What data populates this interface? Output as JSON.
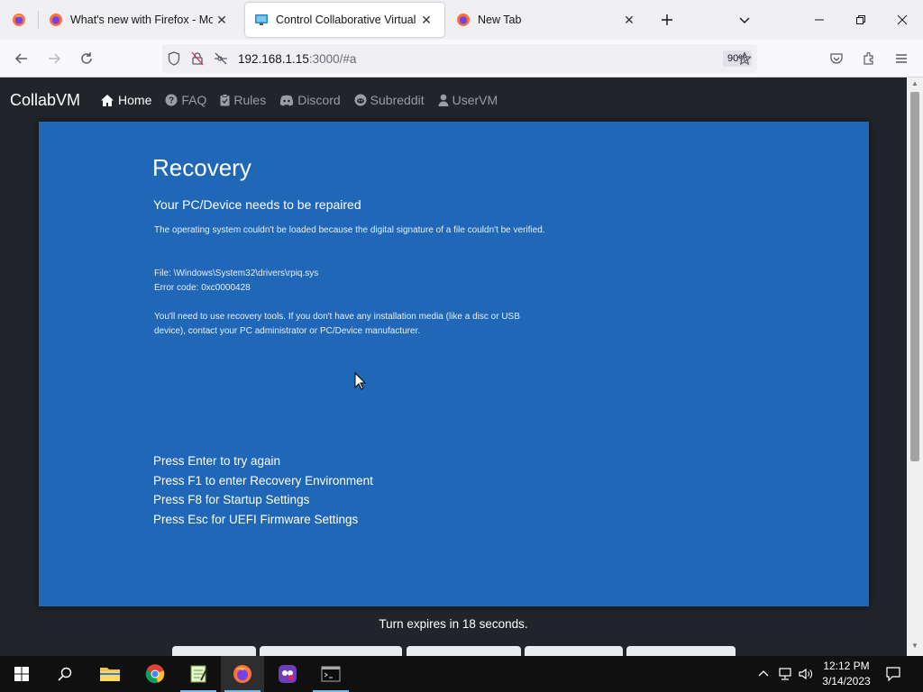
{
  "browser": {
    "tabs": [
      {
        "title": "What's new with Firefox - More",
        "active": false
      },
      {
        "title": "Control Collaborative Virtual M",
        "active": true
      },
      {
        "title": "New Tab",
        "active": false
      }
    ],
    "url_host": "192.168.1.15",
    "url_rest": ":3000/#a",
    "zoom": "90%"
  },
  "site": {
    "brand": "CollabVM",
    "nav": [
      {
        "label": "Home",
        "icon": "home-icon",
        "active": true
      },
      {
        "label": "FAQ",
        "icon": "question-icon",
        "active": false
      },
      {
        "label": "Rules",
        "icon": "clipboard-icon",
        "active": false
      },
      {
        "label": "Discord",
        "icon": "discord-icon",
        "active": false
      },
      {
        "label": "Subreddit",
        "icon": "reddit-icon",
        "active": false
      },
      {
        "label": "UserVM",
        "icon": "user-icon",
        "active": false
      }
    ],
    "turn_text": "Turn expires in 18 seconds."
  },
  "recovery": {
    "title": "Recovery",
    "subtitle": "Your PC/Device needs to be repaired",
    "message": "The operating system couldn't be loaded because the digital signature of a file couldn't be verified.",
    "file_line": "File: \\Windows\\System32\\drivers\\rpiq.sys",
    "error_line": "Error code: 0xc0000428",
    "advice": "You'll need to use recovery tools. If you don't have any installation media (like a disc or USB device), contact your PC administrator or PC/Device manufacturer.",
    "keys": [
      "Press Enter to try again",
      "Press F1 to enter Recovery Environment",
      "Press F8 for Startup Settings",
      "Press Esc for UEFI Firmware Settings"
    ],
    "bg_color": "#2067b8"
  },
  "taskbar": {
    "time": "12:12 PM",
    "date": "3/14/2023"
  }
}
